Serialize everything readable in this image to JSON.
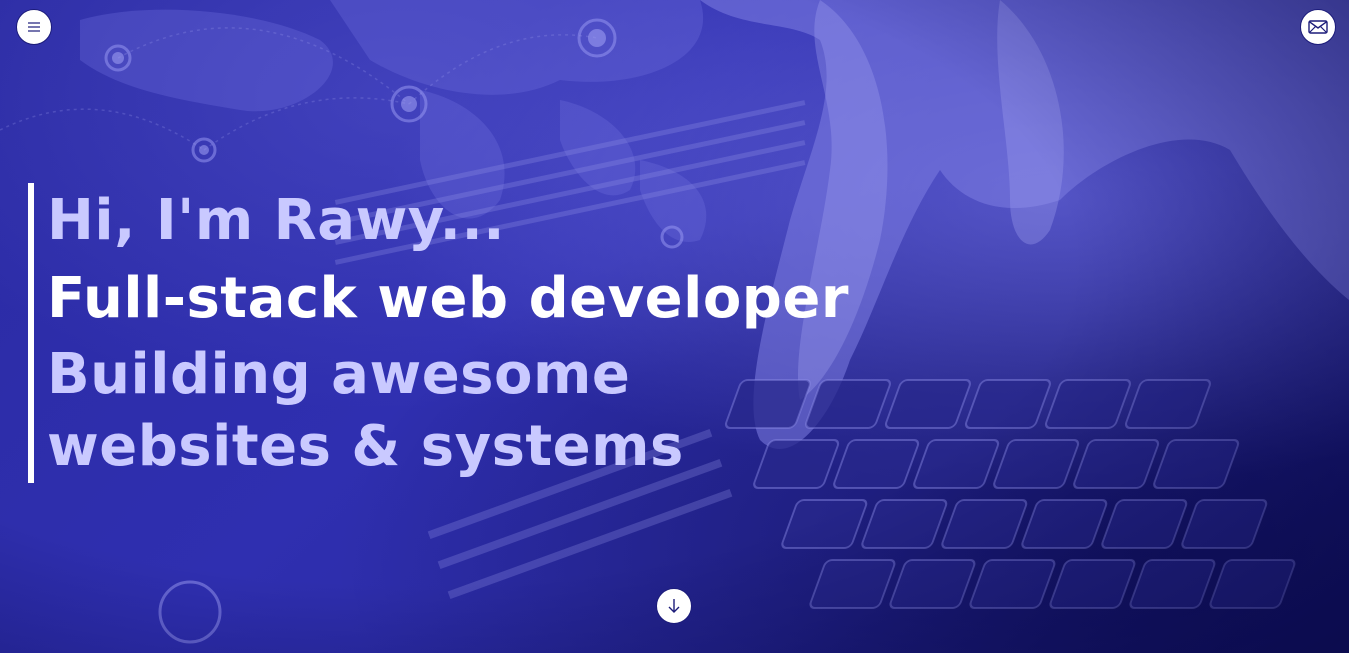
{
  "header": {
    "menu_icon": "hamburger-icon",
    "mail_icon": "envelope-icon"
  },
  "intro": {
    "greeting": "Hi, I'm Rawy...",
    "role": "Full-stack web developer",
    "tagline": "Building awesome websites & systems"
  },
  "scroll": {
    "icon": "arrow-down-icon"
  },
  "colors": {
    "background": "#2d2dab",
    "accent_text": "#c9c9ff",
    "primary_text": "#ffffff",
    "button_bg": "#ffffff",
    "button_icon": "#1c1c7a"
  }
}
